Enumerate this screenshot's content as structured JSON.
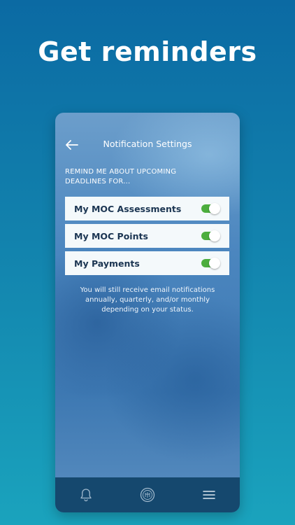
{
  "headline": "Get reminders",
  "header": {
    "title": "Notification Settings",
    "back_icon": "arrow-left-icon"
  },
  "prompt": "REMIND ME ABOUT UPCOMING DEADLINES FOR...",
  "toggles": [
    {
      "label": "My MOC Assessments",
      "on": true
    },
    {
      "label": "My MOC Points",
      "on": true
    },
    {
      "label": "My Payments",
      "on": true
    }
  ],
  "note": "You will still receive email notifications annually, quarterly, and/or monthly depending on your status.",
  "tabbar": {
    "icons": [
      "bell-icon",
      "seal-logo-icon",
      "menu-icon"
    ]
  },
  "colors": {
    "toggle_on": "#4cae3e",
    "tabbar_bg": "#15486e",
    "row_bg": "#f4f9fb",
    "row_text": "#1b3552"
  }
}
